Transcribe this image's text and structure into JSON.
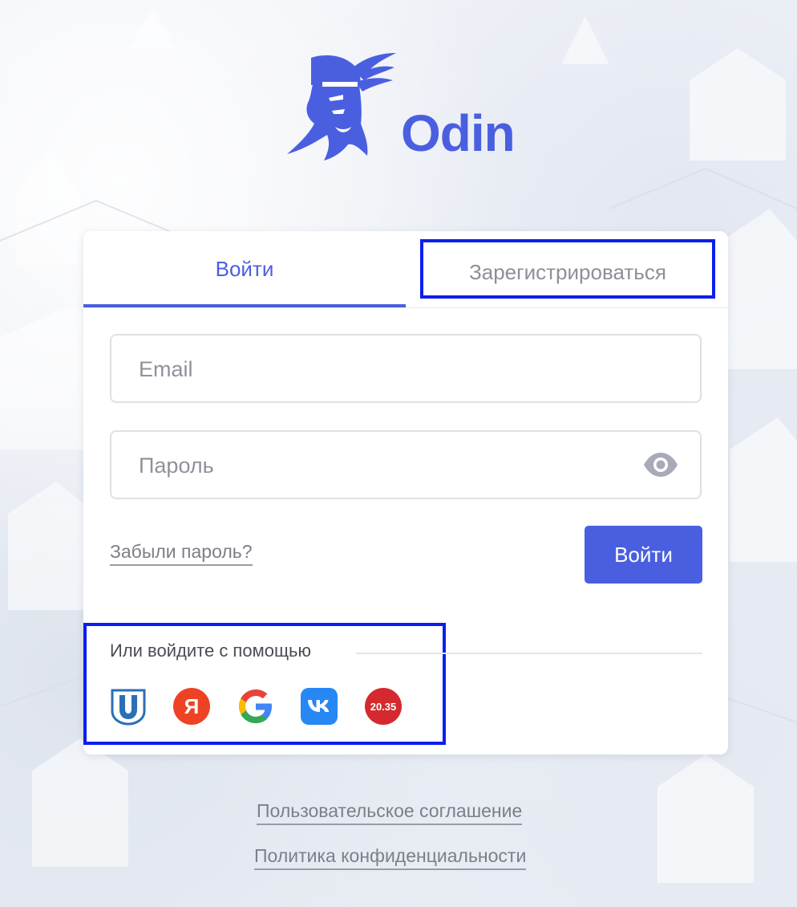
{
  "brand": {
    "name": "Odin",
    "logo_icon": "viking-head-icon",
    "color": "#4a5fe0"
  },
  "tabs": {
    "login": "Войти",
    "register": "Зарегистрироваться"
  },
  "form": {
    "email_placeholder": "Email",
    "password_placeholder": "Пароль",
    "forgot_password": "Забыли пароль?",
    "submit_label": "Войти",
    "password_toggle_icon": "eye-icon"
  },
  "social": {
    "label": "Или войдите с помощью",
    "providers": [
      {
        "name": "university-icon",
        "text": "U"
      },
      {
        "name": "yandex-icon",
        "text": "Я"
      },
      {
        "name": "google-icon",
        "text": "G"
      },
      {
        "name": "vk-icon",
        "text": "vk"
      },
      {
        "name": "2035-icon",
        "text": "20.35"
      }
    ]
  },
  "footer": {
    "terms": "Пользовательское соглашение",
    "privacy": "Политика конфиденциальности"
  },
  "colors": {
    "accent": "#4a5fe0",
    "highlight_box": "#0a1ef0",
    "background": "#eef1f6"
  }
}
